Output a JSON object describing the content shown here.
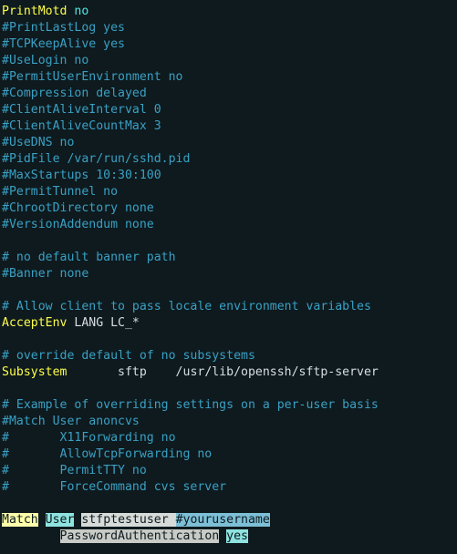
{
  "lines": [
    {
      "spans": [
        {
          "cls": "kw",
          "t": "PrintMotd"
        },
        {
          "cls": "plain",
          "t": " "
        },
        {
          "cls": "val",
          "t": "no"
        }
      ]
    },
    {
      "spans": [
        {
          "cls": "comment",
          "t": "#PrintLastLog yes"
        }
      ]
    },
    {
      "spans": [
        {
          "cls": "comment",
          "t": "#TCPKeepAlive yes"
        }
      ]
    },
    {
      "spans": [
        {
          "cls": "comment",
          "t": "#UseLogin no"
        }
      ]
    },
    {
      "spans": [
        {
          "cls": "comment",
          "t": "#PermitUserEnvironment no"
        }
      ]
    },
    {
      "spans": [
        {
          "cls": "comment",
          "t": "#Compression delayed"
        }
      ]
    },
    {
      "spans": [
        {
          "cls": "comment",
          "t": "#ClientAliveInterval 0"
        }
      ]
    },
    {
      "spans": [
        {
          "cls": "comment",
          "t": "#ClientAliveCountMax 3"
        }
      ]
    },
    {
      "spans": [
        {
          "cls": "comment",
          "t": "#UseDNS no"
        }
      ]
    },
    {
      "spans": [
        {
          "cls": "comment",
          "t": "#PidFile /var/run/sshd.pid"
        }
      ]
    },
    {
      "spans": [
        {
          "cls": "comment",
          "t": "#MaxStartups 10:30:100"
        }
      ]
    },
    {
      "spans": [
        {
          "cls": "comment",
          "t": "#PermitTunnel no"
        }
      ]
    },
    {
      "spans": [
        {
          "cls": "comment",
          "t": "#ChrootDirectory none"
        }
      ]
    },
    {
      "spans": [
        {
          "cls": "comment",
          "t": "#VersionAddendum none"
        }
      ]
    },
    {
      "spans": []
    },
    {
      "spans": [
        {
          "cls": "comment",
          "t": "# no default banner path"
        }
      ]
    },
    {
      "spans": [
        {
          "cls": "comment",
          "t": "#Banner none"
        }
      ]
    },
    {
      "spans": []
    },
    {
      "spans": [
        {
          "cls": "comment",
          "t": "# Allow client to pass locale environment variables"
        }
      ]
    },
    {
      "spans": [
        {
          "cls": "kw",
          "t": "AcceptEnv"
        },
        {
          "cls": "plain",
          "t": " LANG LC_*"
        }
      ]
    },
    {
      "spans": []
    },
    {
      "spans": [
        {
          "cls": "comment",
          "t": "# override default of no subsystems"
        }
      ]
    },
    {
      "spans": [
        {
          "cls": "kw",
          "t": "Subsystem"
        },
        {
          "cls": "plain",
          "t": "       sftp    /usr/lib/openssh/sftp-server"
        }
      ]
    },
    {
      "spans": []
    },
    {
      "spans": [
        {
          "cls": "comment",
          "t": "# Example of overriding settings on a per-user basis"
        }
      ]
    },
    {
      "spans": [
        {
          "cls": "comment",
          "t": "#Match User anoncvs"
        }
      ]
    },
    {
      "spans": [
        {
          "cls": "comment",
          "t": "#       X11Forwarding no"
        }
      ]
    },
    {
      "spans": [
        {
          "cls": "comment",
          "t": "#       AllowTcpForwarding no"
        }
      ]
    },
    {
      "spans": [
        {
          "cls": "comment",
          "t": "#       PermitTTY no"
        }
      ]
    },
    {
      "spans": [
        {
          "cls": "comment",
          "t": "#       ForceCommand cvs server"
        }
      ]
    },
    {
      "spans": []
    },
    {
      "spans": [
        {
          "cls": "hl-match",
          "t": "Match"
        },
        {
          "cls": "plain",
          "t": " "
        },
        {
          "cls": "hl-user",
          "t": "User"
        },
        {
          "cls": "plain",
          "t": " "
        },
        {
          "cls": "hl-plain",
          "t": "stfptestuser "
        },
        {
          "cls": "hl-comment",
          "t": "#yourusername"
        }
      ]
    },
    {
      "spans": [
        {
          "cls": "plain",
          "t": "        "
        },
        {
          "cls": "hl-pa",
          "t": "PasswordAuthentication"
        },
        {
          "cls": "plain",
          "t": " "
        },
        {
          "cls": "hl-yes",
          "t": "yes"
        }
      ]
    }
  ]
}
